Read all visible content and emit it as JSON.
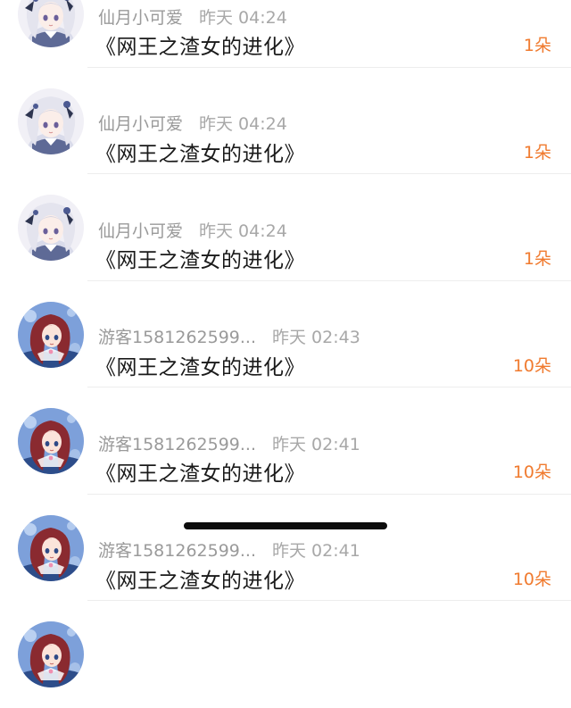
{
  "gift_records": [
    {
      "user": "仙月小可爱",
      "time": "昨天 04:24",
      "book": "《网王之渣女的进化》",
      "amount": "1朵",
      "avatar": "white-hair-anime-girl"
    },
    {
      "user": "仙月小可爱",
      "time": "昨天 04:24",
      "book": "《网王之渣女的进化》",
      "amount": "1朵",
      "avatar": "white-hair-anime-girl"
    },
    {
      "user": "仙月小可爱",
      "time": "昨天 04:24",
      "book": "《网王之渣女的进化》",
      "amount": "1朵",
      "avatar": "white-hair-anime-girl"
    },
    {
      "user": "游客1581262599...",
      "time": "昨天 02:43",
      "book": "《网王之渣女的进化》",
      "amount": "10朵",
      "avatar": "red-hair-anime-girl"
    },
    {
      "user": "游客1581262599...",
      "time": "昨天 02:41",
      "book": "《网王之渣女的进化》",
      "amount": "10朵",
      "avatar": "red-hair-anime-girl"
    },
    {
      "user": "游客1581262599...",
      "time": "昨天 02:41",
      "book": "《网王之渣女的进化》",
      "amount": "10朵",
      "avatar": "red-hair-anime-girl"
    },
    {
      "user": "",
      "time": "",
      "book": "",
      "amount": "",
      "avatar": "red-hair-anime-girl"
    }
  ],
  "colors": {
    "accent": "#f07a2e",
    "username": "#9a9a9a",
    "title": "#1a1a1a",
    "divider": "#ededed"
  }
}
